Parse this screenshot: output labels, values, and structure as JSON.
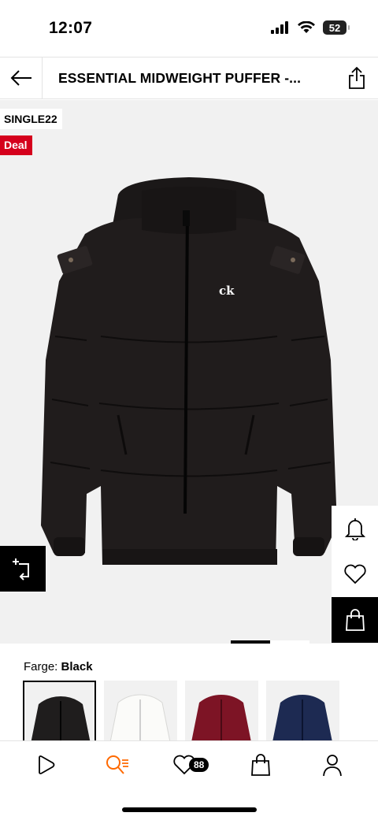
{
  "status": {
    "time": "12:07",
    "battery": "52"
  },
  "header": {
    "title": "ESSENTIAL MIDWEIGHT PUFFER -..."
  },
  "product": {
    "promo_code": "SINGLE22",
    "deal_label": "Deal",
    "jacket_color_hex": "#1e1b1b",
    "brand_mark": "ck"
  },
  "color_select": {
    "label": "Farge:",
    "selected": "Black",
    "swatches": [
      {
        "color": "#1f1d1d",
        "selected": true
      },
      {
        "color": "#f6f6f4",
        "selected": false
      },
      {
        "color": "#7d1425",
        "selected": false
      },
      {
        "color": "#1d2a52",
        "selected": false
      }
    ]
  },
  "nav": {
    "wishlist_count": "88"
  },
  "colors": {
    "deal": "#d5001c",
    "accent": "#ff6900"
  },
  "icons": [
    "back-arrow-icon",
    "share-icon",
    "compare-icon",
    "bell-icon",
    "heart-icon",
    "shopping-bag-icon",
    "play-icon",
    "search-icon",
    "user-icon"
  ]
}
